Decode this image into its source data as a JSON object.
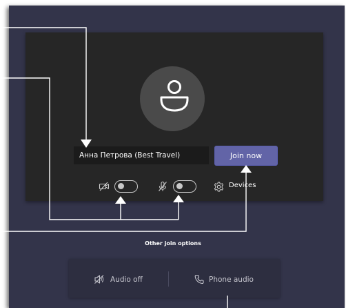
{
  "user": {
    "name": "Анна Петрова (Best Travel)"
  },
  "pre_join": {
    "join_label": "Join now",
    "camera_toggle": "off",
    "mic_toggle": "off",
    "devices_label": "Devices"
  },
  "other_options": {
    "title": "Other join options",
    "audio_off_label": "Audio off",
    "phone_audio_label": "Phone audio"
  },
  "colors": {
    "frame_bg": "#33344a",
    "panel_bg": "#262626",
    "accent": "#6264a7",
    "annotation": "#ffffff"
  },
  "icons": [
    "person-icon",
    "camera-off-icon",
    "mic-off-icon",
    "gear-icon",
    "speaker-off-icon",
    "phone-icon"
  ]
}
